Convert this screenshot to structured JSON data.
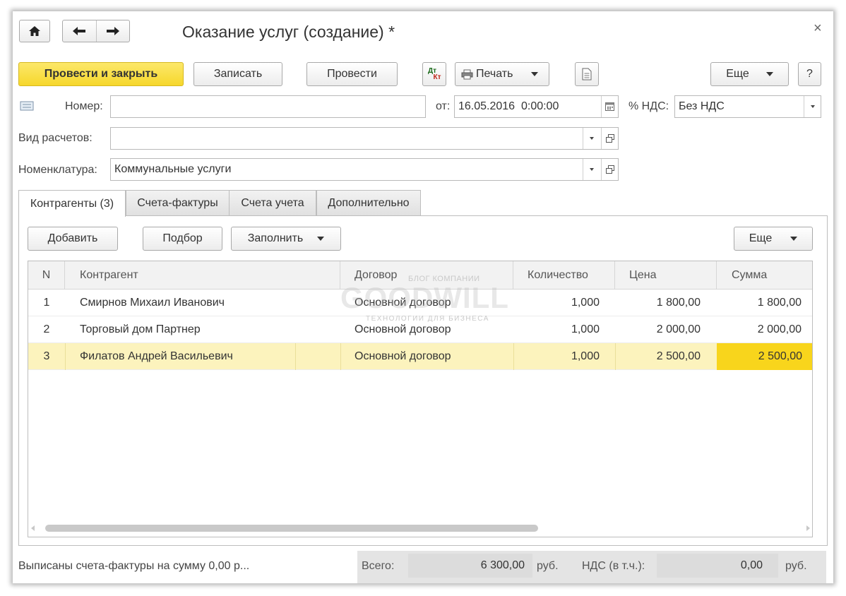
{
  "window": {
    "title": "Оказание услуг (создание) *",
    "close_glyph": "×"
  },
  "nav": {
    "home_glyph": "⌂",
    "back_glyph": "←",
    "forward_glyph": "→"
  },
  "toolbar": {
    "post_close": "Провести и закрыть",
    "save": "Записать",
    "post": "Провести",
    "dtkt_top": "Дт",
    "dtkt_bottom": "Кт",
    "print": "Печать",
    "more": "Еще",
    "help": "?"
  },
  "form": {
    "number_label": "Номер:",
    "number_value": "",
    "date_label": "от:",
    "date_value": "16.05.2016  0:00:00",
    "vat_label": "% НДС:",
    "vat_value": "Без НДС",
    "payment_type_label": "Вид расчетов:",
    "payment_type_value": "",
    "nomenclature_label": "Номенклатура:",
    "nomenclature_value": "Коммунальные услуги"
  },
  "tabs": [
    {
      "label": "Контрагенты (3)",
      "active": true
    },
    {
      "label": "Счета-фактуры",
      "active": false
    },
    {
      "label": "Счета учета",
      "active": false
    },
    {
      "label": "Дополнительно",
      "active": false
    }
  ],
  "table_toolbar": {
    "add": "Добавить",
    "pick": "Подбор",
    "fill": "Заполнить",
    "more": "Еще"
  },
  "table": {
    "columns": [
      "N",
      "Контрагент",
      "Договор",
      "Количество",
      "Цена",
      "Сумма"
    ],
    "rows": [
      {
        "n": "1",
        "counterparty": "Смирнов Михаил Иванович",
        "contract": "Основной договор",
        "qty": "1,000",
        "price": "1 800,00",
        "sum": "1 800,00"
      },
      {
        "n": "2",
        "counterparty": "Торговый дом Партнер",
        "contract": "Основной договор",
        "qty": "1,000",
        "price": "2 000,00",
        "sum": "2 000,00"
      },
      {
        "n": "3",
        "counterparty": "Филатов Андрей Васильевич",
        "contract": "Основной договор",
        "qty": "1,000",
        "price": "2 500,00",
        "sum": "2 500,00"
      }
    ],
    "selected_row": 3
  },
  "watermark": {
    "top": "БЛОГ КОМПАНИИ",
    "main": "GOODWILL",
    "bottom": "ТЕХНОЛОГИИ ДЛЯ БИЗНЕСА"
  },
  "footer": {
    "invoices_text": "Выписаны счета-фактуры на сумму 0,00 р...",
    "total_label": "Всего:",
    "total_value": "6 300,00",
    "total_currency": "руб.",
    "vat_label": "НДС (в т.ч.):",
    "vat_value": "0,00",
    "vat_currency": "руб."
  },
  "colors": {
    "accent_yellow": "#f6d72c",
    "selected_row": "#fcf3bd",
    "selected_cell": "#f8d51c"
  }
}
